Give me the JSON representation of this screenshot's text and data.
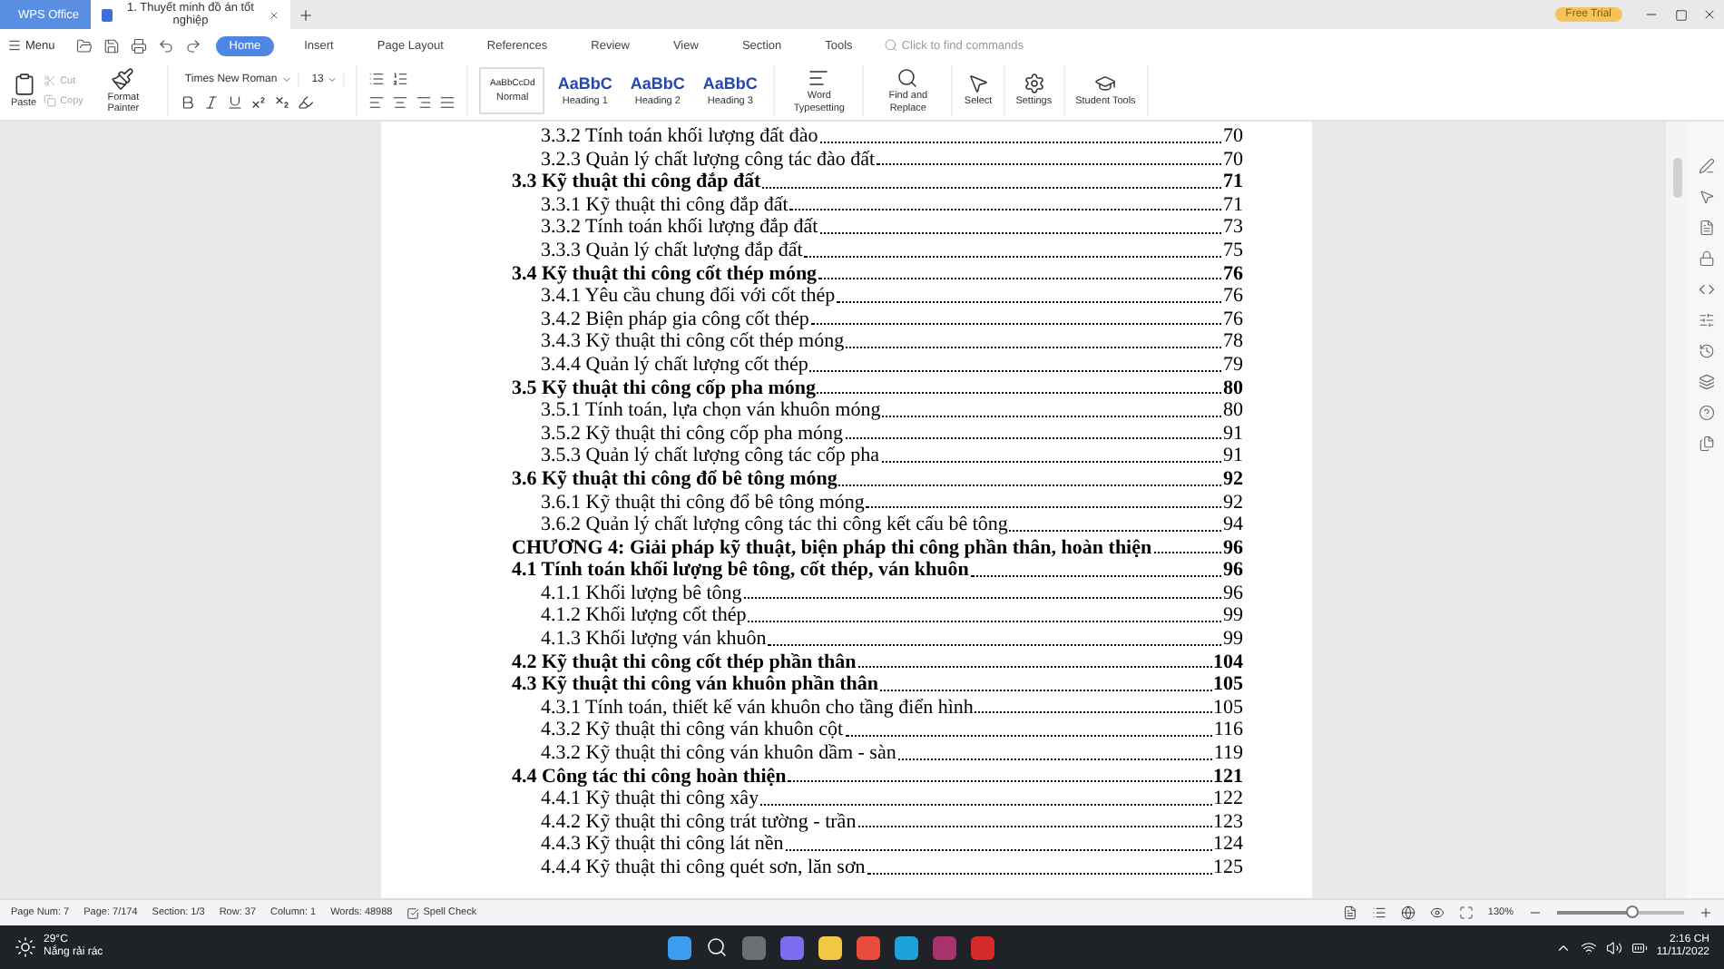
{
  "title_bar": {
    "app_tab": "WPS Office",
    "document_tab": "1. Thuyết minh đồ án tốt nghiệp",
    "badge": "Free Trial"
  },
  "menu": {
    "label": "Menu",
    "search_placeholder": "Click to find commands"
  },
  "menu_tabs": [
    {
      "label": "Home",
      "selected": true
    },
    {
      "label": "Insert",
      "selected": false
    },
    {
      "label": "Page Layout",
      "selected": false
    },
    {
      "label": "References",
      "selected": false
    },
    {
      "label": "Review",
      "selected": false
    },
    {
      "label": "View",
      "selected": false
    },
    {
      "label": "Section",
      "selected": false
    },
    {
      "label": "Tools",
      "selected": false
    }
  ],
  "ribbon": {
    "paste": "Paste",
    "cut": "Cut",
    "copy": "Copy",
    "format_painter": "Format Painter",
    "font_name": "Times New Roman",
    "font_size": "13",
    "styles": [
      {
        "preview": "AaBbCcDd",
        "label": "Normal",
        "kind": "normal",
        "selected": true
      },
      {
        "preview": "AaBbC",
        "label": "Heading 1",
        "kind": "heading",
        "selected": false
      },
      {
        "preview": "AaBbC",
        "label": "Heading 2",
        "kind": "heading",
        "selected": false
      },
      {
        "preview": "AaBbC",
        "label": "Heading 3",
        "kind": "heading",
        "selected": false
      }
    ],
    "tools": [
      {
        "label": "Word Typesetting",
        "kind": "typeset"
      },
      {
        "label": "Find and Replace",
        "kind": "find"
      },
      {
        "label": "Select",
        "kind": "select"
      },
      {
        "label": "Settings",
        "kind": "settings"
      },
      {
        "label": "Student Tools",
        "kind": "student"
      }
    ]
  },
  "toc": [
    {
      "text": "3.3.2 Tính toán khối lượng đất đào",
      "page": "70",
      "kind": "sub"
    },
    {
      "text": "3.2.3 Quản lý chất lượng công tác đào đất",
      "page": "70",
      "kind": "sub"
    },
    {
      "text": "3.3 Kỹ thuật thi công đắp đất",
      "page": "71",
      "kind": "heading"
    },
    {
      "text": "3.3.1 Kỹ thuật thi công đắp đất",
      "page": "71",
      "kind": "sub"
    },
    {
      "text": "3.3.2 Tính toán khối lượng đắp đất",
      "page": "73",
      "kind": "sub"
    },
    {
      "text": "3.3.3 Quản lý chất lượng đắp đất",
      "page": "75",
      "kind": "sub"
    },
    {
      "text": "3.4 Kỹ thuật thi công cốt thép móng",
      "page": "76",
      "kind": "heading"
    },
    {
      "text": "3.4.1 Yêu cầu chung đối với cốt thép",
      "page": "76",
      "kind": "sub"
    },
    {
      "text": "3.4.2 Biện pháp gia công cốt thép",
      "page": "76",
      "kind": "sub"
    },
    {
      "text": "3.4.3 Kỹ thuật thi công cốt thép móng",
      "page": "78",
      "kind": "sub"
    },
    {
      "text": "3.4.4 Quản lý chất lượng cốt thép",
      "page": "79",
      "kind": "sub"
    },
    {
      "text": "3.5 Kỹ thuật thi công cốp pha móng",
      "page": "80",
      "kind": "heading"
    },
    {
      "text": "3.5.1 Tính toán, lựa chọn ván khuôn móng",
      "page": "80",
      "kind": "sub"
    },
    {
      "text": "3.5.2 Kỹ thuật thi công cốp pha móng",
      "page": "91",
      "kind": "sub"
    },
    {
      "text": "3.5.3 Quản lý chất lượng công tác cốp pha",
      "page": "91",
      "kind": "sub"
    },
    {
      "text": "3.6 Kỹ thuật thi công đổ bê tông móng",
      "page": "92",
      "kind": "heading"
    },
    {
      "text": "3.6.1 Kỹ thuật thi công đổ bê tông móng",
      "page": "92",
      "kind": "sub"
    },
    {
      "text": "3.6.2 Quản lý chất lượng công tác thi công kết cấu bê tông",
      "page": "94",
      "kind": "sub"
    },
    {
      "text": "CHƯƠNG 4: Giải pháp kỹ thuật, biện pháp thi công phần thân, hoàn thiện",
      "page": "96",
      "kind": "heading"
    },
    {
      "text": "4.1 Tính toán khối lượng bê tông, cốt thép, ván khuôn",
      "page": "96",
      "kind": "heading"
    },
    {
      "text": "4.1.1 Khối lượng bê tông",
      "page": "96",
      "kind": "sub"
    },
    {
      "text": "4.1.2 Khối lượng cốt thép",
      "page": "99",
      "kind": "sub"
    },
    {
      "text": "4.1.3 Khối lượng ván khuôn",
      "page": "99",
      "kind": "sub"
    },
    {
      "text": "4.2 Kỹ thuật thi công cốt thép phần thân",
      "page": "104",
      "kind": "heading"
    },
    {
      "text": "4.3 Kỹ thuật thi công ván khuôn phần thân",
      "page": "105",
      "kind": "heading"
    },
    {
      "text": "4.3.1 Tính toán, thiết kế ván khuôn cho tầng điển hình",
      "page": "105",
      "kind": "sub"
    },
    {
      "text": "4.3.2 Kỹ thuật thi công ván khuôn cột",
      "page": "116",
      "kind": "sub"
    },
    {
      "text": "4.3.2 Kỹ thuật thi công ván khuôn dầm - sàn",
      "page": "119",
      "kind": "sub"
    },
    {
      "text": "4.4 Công tác thi công hoàn thiện",
      "page": "121",
      "kind": "heading"
    },
    {
      "text": "4.4.1 Kỹ thuật thi công xây",
      "page": "122",
      "kind": "sub"
    },
    {
      "text": "4.4.2 Kỹ thuật thi công trát tường - trần",
      "page": "123",
      "kind": "sub"
    },
    {
      "text": "4.4.3 Kỹ thuật thi công lát nền",
      "page": "124",
      "kind": "sub"
    },
    {
      "text": "4.4.4 Kỹ thuật thi công quét sơn, lăn sơn",
      "page": "125",
      "kind": "sub"
    }
  ],
  "status_bar": {
    "items": [
      "Page Num: 7",
      "Page: 7/174",
      "Section: 1/3",
      "Row: 37",
      "Column: 1",
      "Words: 48988"
    ],
    "spell_check": "Spell Check",
    "zoom": {
      "reading": "130%",
      "level": 0.58
    }
  },
  "taskbar": {
    "temperature": "29°C",
    "weather": "Nắng rải rác",
    "time": "2:16 CH",
    "date": "11/11/2022"
  }
}
